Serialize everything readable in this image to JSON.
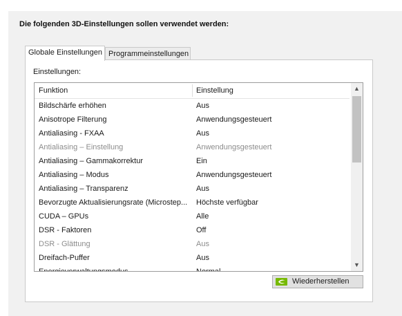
{
  "heading": "Die folgenden 3D-Einstellungen sollen verwendet werden:",
  "tabs": [
    {
      "label": "Globale Einstellungen",
      "active": true
    },
    {
      "label": "Programmeinstellungen",
      "active": false
    }
  ],
  "settings_label": "Einstellungen:",
  "columns": {
    "function": "Funktion",
    "setting": "Einstellung"
  },
  "rows": [
    {
      "function": "Bildschärfe erhöhen",
      "setting": "Aus",
      "disabled": false
    },
    {
      "function": "Anisotrope Filterung",
      "setting": "Anwendungsgesteuert",
      "disabled": false
    },
    {
      "function": "Antialiasing - FXAA",
      "setting": "Aus",
      "disabled": false
    },
    {
      "function": "Antialiasing – Einstellung",
      "setting": "Anwendungsgesteuert",
      "disabled": true
    },
    {
      "function": "Antialiasing – Gammakorrektur",
      "setting": "Ein",
      "disabled": false
    },
    {
      "function": "Antialiasing – Modus",
      "setting": "Anwendungsgesteuert",
      "disabled": false
    },
    {
      "function": "Antialiasing – Transparenz",
      "setting": "Aus",
      "disabled": false
    },
    {
      "function": "Bevorzugte Aktualisierungsrate (Microstep...",
      "setting": "Höchste verfügbar",
      "disabled": false
    },
    {
      "function": "CUDA – GPUs",
      "setting": "Alle",
      "disabled": false
    },
    {
      "function": "DSR - Faktoren",
      "setting": "Off",
      "disabled": false
    },
    {
      "function": "DSR - Glättung",
      "setting": "Aus",
      "disabled": true
    },
    {
      "function": "Dreifach-Puffer",
      "setting": "Aus",
      "disabled": false
    },
    {
      "function": "Energieverwaltungsmodus",
      "setting": "Normal",
      "disabled": false
    }
  ],
  "restore_button": "Wiederherstellen",
  "colors": {
    "nvidia_green": "#76b900",
    "disabled_text": "#8c8c8c"
  }
}
